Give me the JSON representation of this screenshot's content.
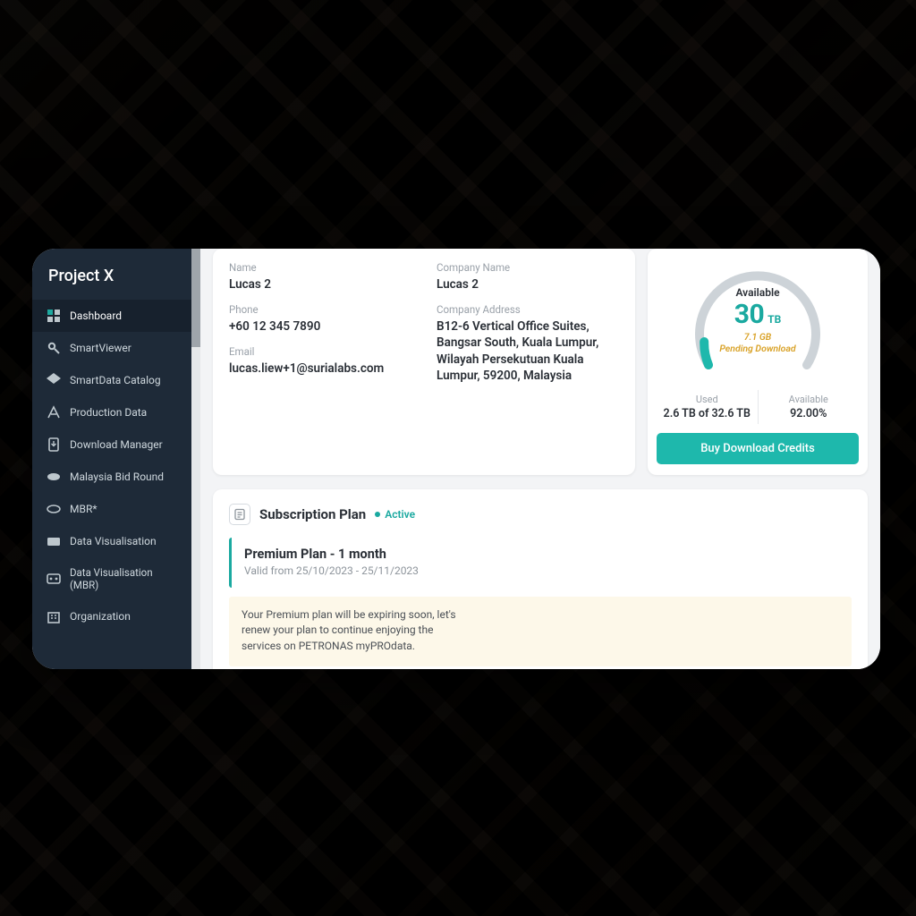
{
  "sidebar": {
    "title": "Project X",
    "items": [
      {
        "label": "Dashboard",
        "icon": "dashboard-icon",
        "active": true
      },
      {
        "label": "SmartViewer",
        "icon": "smartviewer-icon"
      },
      {
        "label": "SmartData Catalog",
        "icon": "catalog-icon"
      },
      {
        "label": "Production Data",
        "icon": "production-icon"
      },
      {
        "label": "Download Manager",
        "icon": "download-icon"
      },
      {
        "label": "Malaysia Bid Round",
        "icon": "mbr-icon"
      },
      {
        "label": "MBR*",
        "icon": "mbrplus-icon"
      },
      {
        "label": "Data Visualisation",
        "icon": "viz-icon"
      },
      {
        "label": "Data Visualisation (MBR)",
        "icon": "vizmbr-icon",
        "twoline": true
      },
      {
        "label": "Organization",
        "icon": "org-icon"
      }
    ]
  },
  "profile": {
    "name_label": "Name",
    "name_value": "Lucas 2",
    "phone_label": "Phone",
    "phone_value": "+60 12 345 7890",
    "email_label": "Email",
    "email_value": "lucas.liew+1@surialabs.com",
    "company_label": "Company Name",
    "company_value": "Lucas 2",
    "address_label": "Company Address",
    "address_value": "B12-6 Vertical Office Suites, Bangsar South,  Kuala Lumpur, Wilayah Persekutuan Kuala Lumpur, 59200, Malaysia"
  },
  "credits": {
    "available_label": "Available",
    "available_value": "30",
    "available_unit": "TB",
    "pending_size": "7.1 GB",
    "pending_label": "Pending Download",
    "used_label": "Used",
    "used_value": "2.6 TB  of  32.6 TB",
    "avail_pct_label": "Available",
    "avail_pct_value": "92.00%",
    "buy_label": "Buy Download Credits"
  },
  "subscription": {
    "section_title": "Subscription Plan",
    "status": "Active",
    "plan_name": "Premium Plan - 1 month",
    "valid": "Valid from 25/10/2023 - 25/11/2023",
    "warning": "Your Premium plan will be expiring soon, let's renew your plan to continue enjoying the services on PETRONAS myPROdata."
  }
}
